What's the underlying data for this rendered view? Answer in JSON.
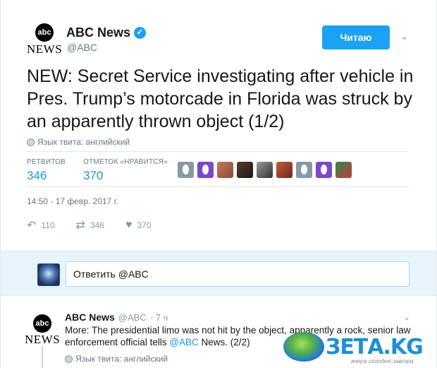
{
  "tweet": {
    "author_name": "ABC News",
    "handle": "@ABC",
    "logo_top": "abc",
    "logo_bottom": "NEWS",
    "follow_label": "Читаю",
    "text": "NEW: Secret Service investigating after vehicle in Pres. Trump’s motorcade in Florida was struck by an apparently thrown object (1/2)",
    "lang_label": "Язык твита: английский",
    "retweets_label": "РЕТВИТОВ",
    "retweets_value": "346",
    "likes_label": "ОТМЕТОК «НРАВИТСЯ»",
    "likes_value": "370",
    "timestamp": "14:50 - 17 февр. 2017 г.",
    "reply_count": "110",
    "retweet_count": "346",
    "like_count": "370"
  },
  "reply_box": {
    "placeholder": "Ответить @ABC"
  },
  "second_tweet": {
    "author_name": "ABC News",
    "handle": "@ABC",
    "time": "· 7 ч",
    "text_part1": "More: The presidential limo was not hit by the object, apparently a rock, senior law enforcement official tells ",
    "mention": "@ABC",
    "text_part2": " News. (2/2)",
    "lang_label": "Язык твита: английский"
  },
  "watermark": {
    "brand": "ЗЕТА.KG",
    "tagline": "вчера сегодня завтра"
  },
  "colors": {
    "accent": "#1da1f2",
    "link": "#1b95e0",
    "muted": "#657786",
    "reply_bg": "#e8f4fb"
  },
  "icons": [
    "verified-badge-icon",
    "chevron-down-icon",
    "globe-icon",
    "reply-icon",
    "retweet-icon",
    "heart-icon"
  ]
}
